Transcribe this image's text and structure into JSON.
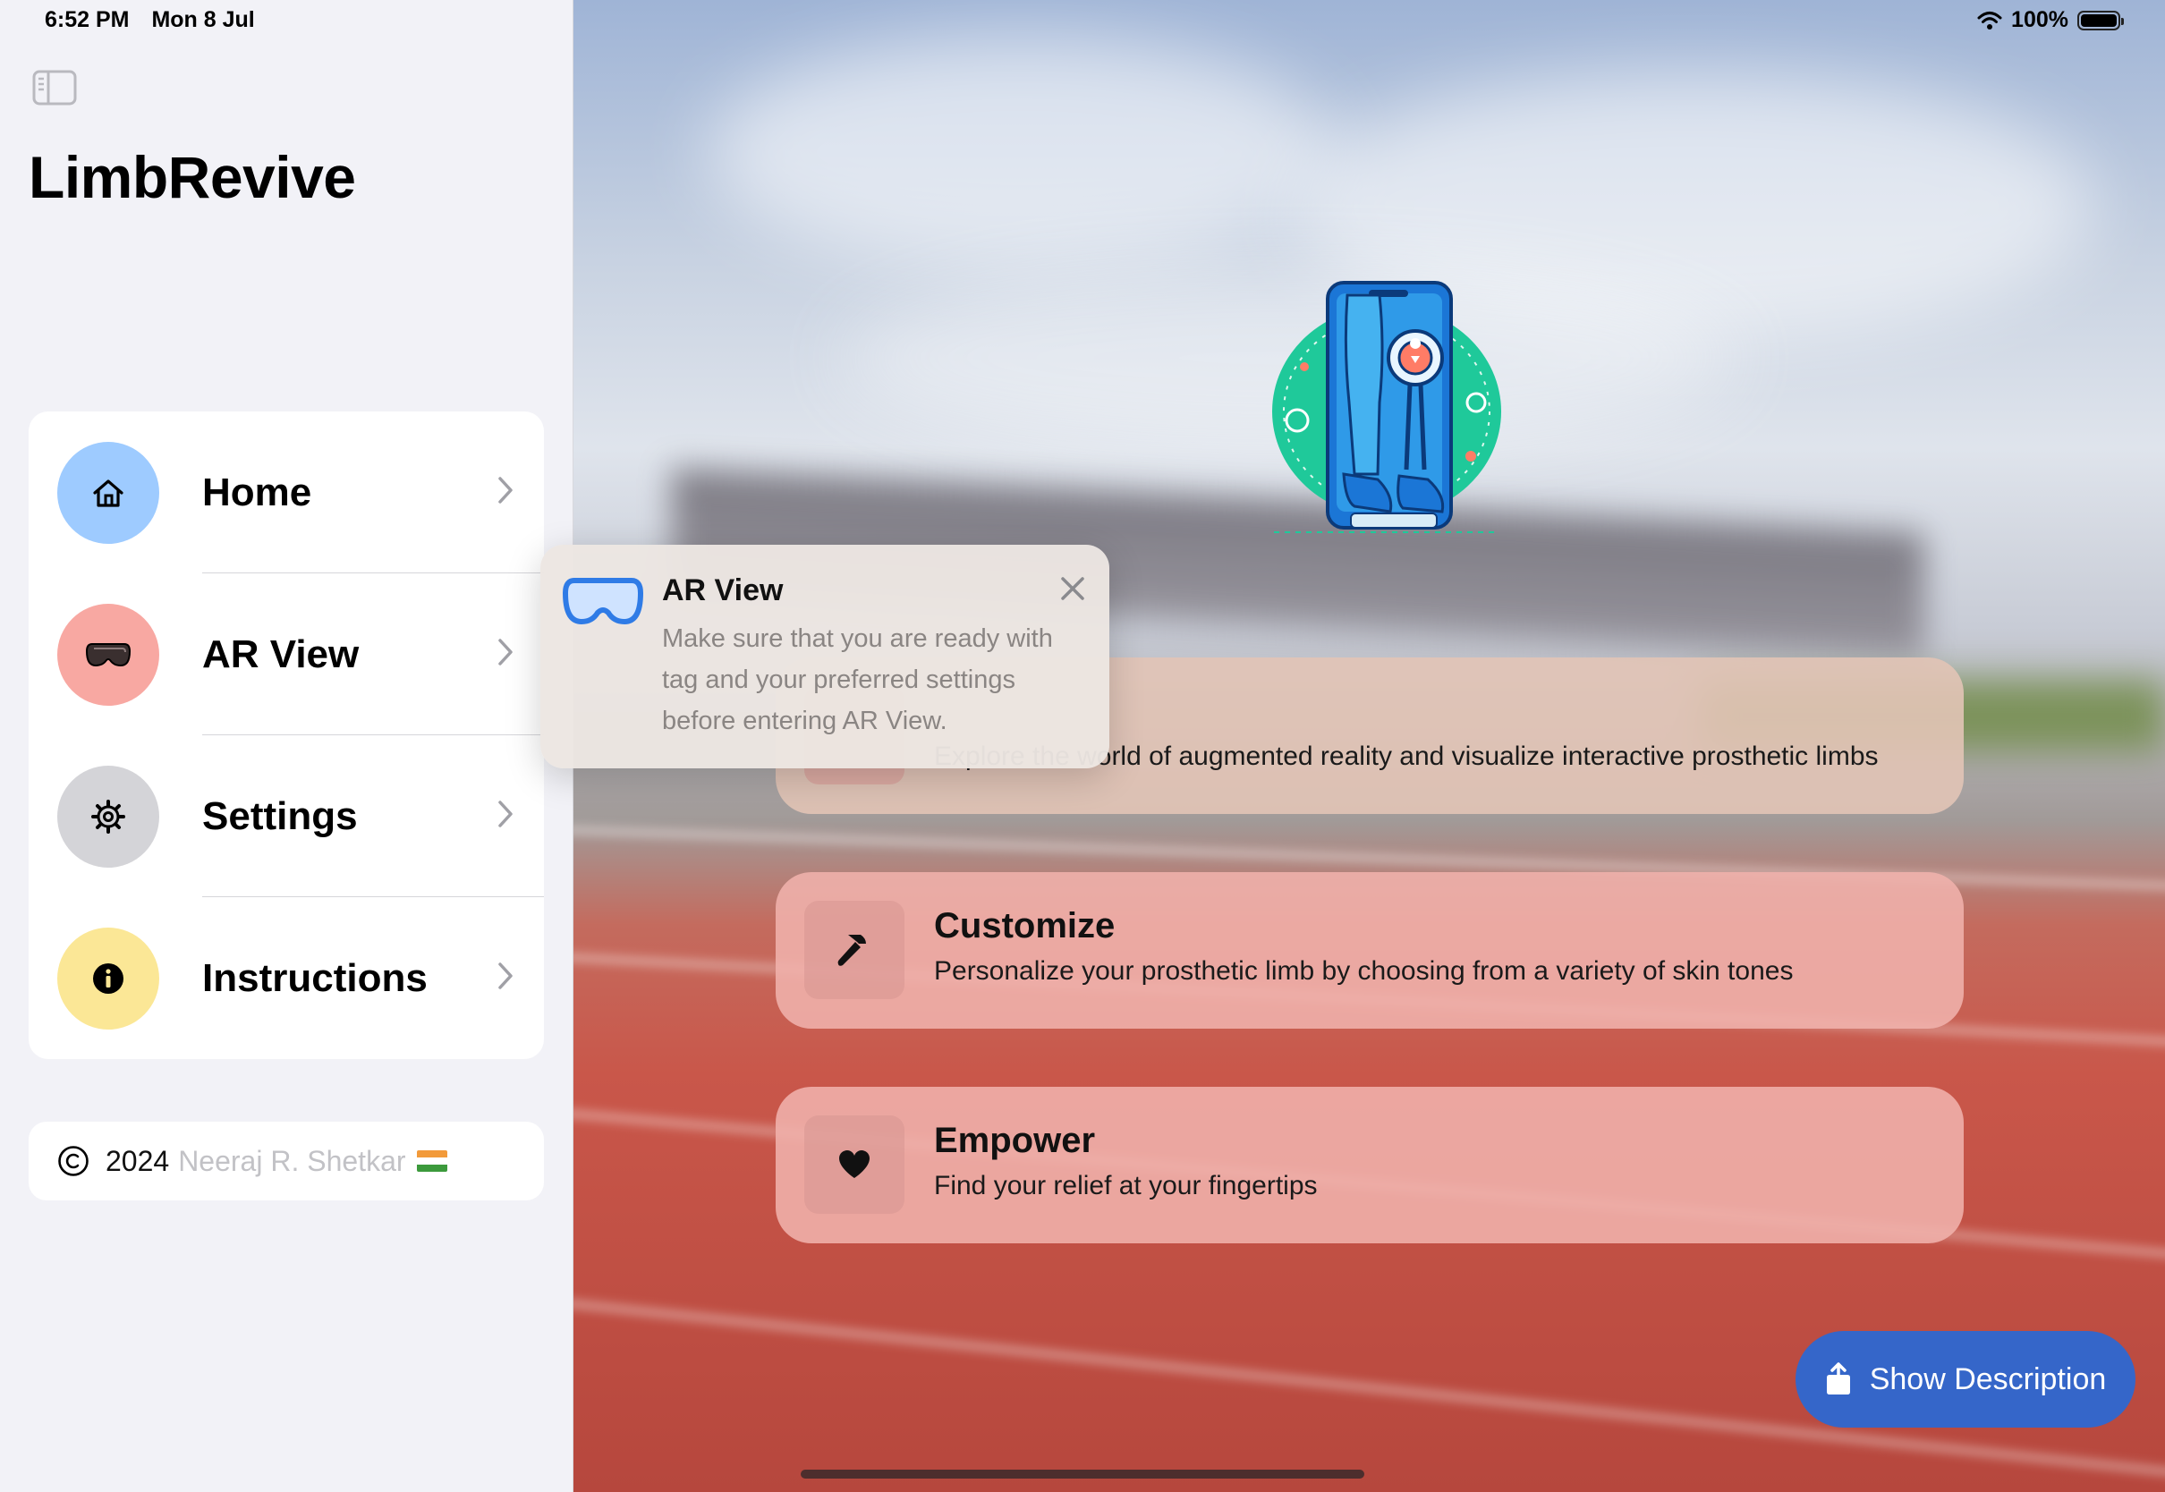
{
  "status_bar": {
    "time": "6:52 PM",
    "date": "Mon 8 Jul",
    "battery": "100%"
  },
  "sidebar": {
    "title": "LimbRevive",
    "items": [
      {
        "label": "Home",
        "icon": "house-icon",
        "color": "#9ecbff"
      },
      {
        "label": "AR View",
        "icon": "vision-headset-icon",
        "color": "#f8a8a2"
      },
      {
        "label": "Settings",
        "icon": "gear-icon",
        "color": "#d4d4d8"
      },
      {
        "label": "Instructions",
        "icon": "info-icon",
        "color": "#fbe796"
      }
    ],
    "footer": {
      "year": "2024",
      "author": "Neeraj R. Shetkar"
    }
  },
  "features": [
    {
      "title": "",
      "description": "Explore the world of augmented reality and visualize interactive prosthetic limbs",
      "icon": "vision-headset-icon"
    },
    {
      "title": "Customize",
      "description": "Personalize your prosthetic limb by choosing from a variety of skin tones",
      "icon": "hammer-icon"
    },
    {
      "title": "Empower",
      "description": "Find your relief at your fingertips",
      "icon": "heart-icon"
    }
  ],
  "popover": {
    "title": "AR View",
    "body": "Make sure that you are ready with tag and your preferred settings before entering AR View."
  },
  "actions": {
    "show_description": "Show Description"
  },
  "colors": {
    "accent": "#3566c9",
    "card": "#f0b2ac"
  }
}
